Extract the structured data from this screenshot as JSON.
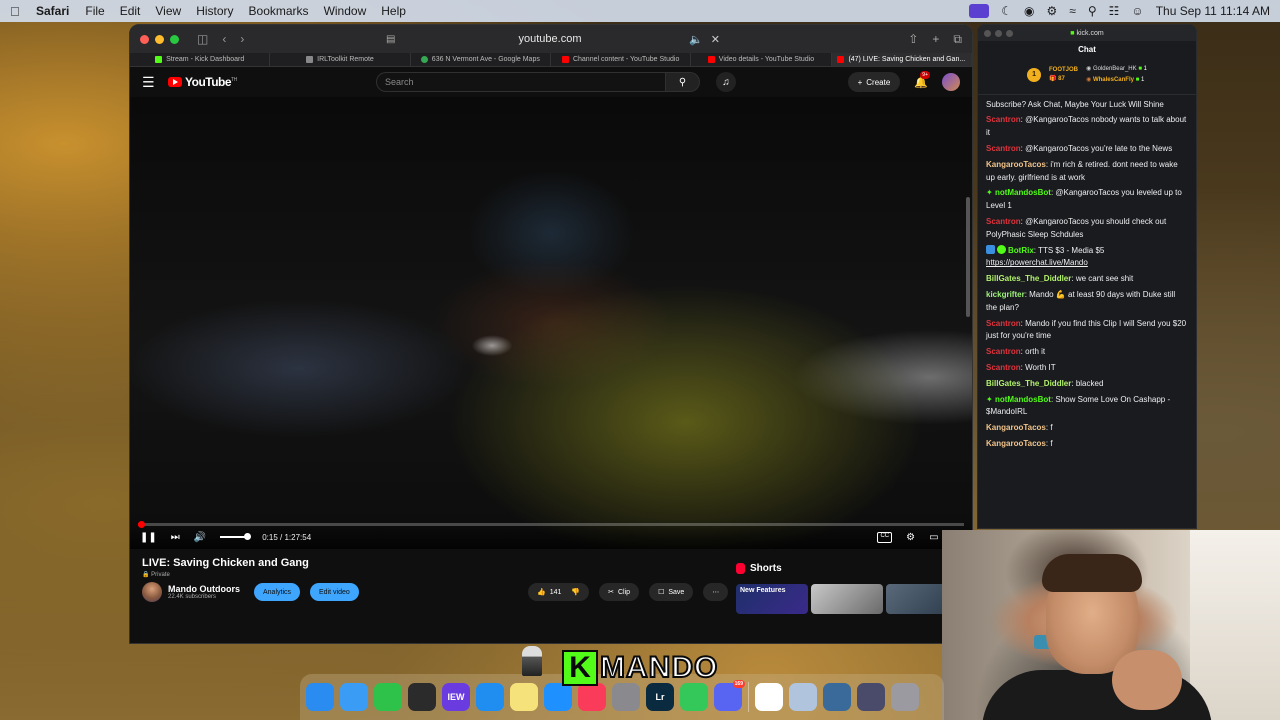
{
  "menubar": {
    "app": "Safari",
    "items": [
      "File",
      "Edit",
      "View",
      "History",
      "Bookmarks",
      "Window",
      "Help"
    ],
    "clock": "Thu Sep 11  11:14 AM"
  },
  "safari": {
    "url": "youtube.com",
    "tabs": [
      {
        "label": "Stream - Kick Dashboard",
        "color": "#53fc18"
      },
      {
        "label": "IRLToolkit Remote",
        "color": "#888888"
      },
      {
        "label": "636 N Vermont Ave - Google Maps",
        "color": "#34a853"
      },
      {
        "label": "Channel content - YouTube Studio",
        "color": "#ff0000"
      },
      {
        "label": "Video details - YouTube Studio",
        "color": "#ff0000"
      },
      {
        "label": "(47) LIVE: Saving Chicken and Gan...",
        "color": "#ff0000"
      }
    ]
  },
  "youtube": {
    "logo_text": "YouTube",
    "logo_sup": "TH",
    "search_placeholder": "Search",
    "create_label": "Create",
    "notif_count": "9+",
    "player": {
      "time": "0:15 / 1:27:54",
      "progress_fraction": 0.003,
      "cc_label": "CC"
    },
    "video_title": "LIVE: Saving Chicken and Gang",
    "privacy": "Private",
    "channel_name": "Mando Outdoors",
    "subscribers": "22.4K subscribers",
    "analytics_label": "Analytics",
    "edit_video_label": "Edit video",
    "like_count": "141",
    "clip_label": "Clip",
    "save_label": "Save",
    "shorts_label": "Shorts",
    "shorts_thumb_text": "New Features"
  },
  "kick": {
    "url": "kick.com",
    "title": "Chat",
    "pinned": {
      "rank": "1",
      "user": "FOOTJOB",
      "count": "87",
      "list": [
        {
          "name": "GoldenBear_HK",
          "count": "1"
        },
        {
          "name": "WhalesCanFly",
          "count": "1"
        }
      ]
    },
    "messages": [
      {
        "user": "",
        "text": "Subscribe? Ask Chat, Maybe Your Luck Will Shine",
        "color": "u-red",
        "icon": ""
      },
      {
        "user": "Scantron",
        "text": "@KangarooTacos nobody wants to talk about it",
        "color": "u-red",
        "icon": ""
      },
      {
        "user": "Scantron",
        "text": "@KangarooTacos you're late to the News",
        "color": "u-red",
        "icon": ""
      },
      {
        "user": "KangarooTacos",
        "text": "i'm rich & retired. dont need to wake up early. girlfriend is at work",
        "color": "u-yel",
        "icon": ""
      },
      {
        "user": "notMandosBot",
        "text": "@KangarooTacos you leveled up to Level 1",
        "color": "u-grn",
        "icon": "spark"
      },
      {
        "user": "Scantron",
        "text": "@KangarooTacos you should check out PolyPhasic Sleep Schdules",
        "color": "u-red",
        "icon": ""
      },
      {
        "user": "BotRix",
        "text": "TTS $3 - Media $5",
        "link": "https://powerchat.live/Mando",
        "color": "u-grn",
        "icon": "bot"
      },
      {
        "user": "BillGates_The_Diddler",
        "text": "we cant see shit",
        "color": "u-lim",
        "icon": ""
      },
      {
        "user": "kickgrifter",
        "text": "Mando 💪 at least 90 days with Duke still the plan?",
        "color": "u-lgr",
        "icon": ""
      },
      {
        "user": "Scantron",
        "text": "Mando if you find this Clip I will Send you $20 just for you're time",
        "color": "u-red",
        "icon": ""
      },
      {
        "user": "Scantron",
        "text": "orth it",
        "color": "u-red",
        "icon": ""
      },
      {
        "user": "Scantron",
        "text": "Worth IT",
        "color": "u-red",
        "icon": ""
      },
      {
        "user": "BillGates_The_Diddler",
        "text": "blacked",
        "color": "u-lim",
        "icon": ""
      },
      {
        "user": "notMandosBot",
        "text": "Show Some Love On Cashapp - $MandoIRL",
        "color": "u-grn",
        "icon": "spark"
      },
      {
        "user": "KangarooTacos",
        "text": "f",
        "color": "u-yel",
        "icon": ""
      },
      {
        "user": "KangarooTacos",
        "text": "f",
        "color": "u-yel",
        "icon": ""
      }
    ]
  },
  "dock": {
    "icons": [
      {
        "name": "finder",
        "label": "",
        "color": "#2a8cf0"
      },
      {
        "name": "mail",
        "label": "",
        "color": "#3a9cf5"
      },
      {
        "name": "facetime",
        "label": "",
        "color": "#2ec24a"
      },
      {
        "name": "obs",
        "label": "",
        "color": "#2b2b2b"
      },
      {
        "name": "iew",
        "label": "IEW",
        "color": "#6a3ce0"
      },
      {
        "name": "safari",
        "label": "",
        "color": "#1f8ef0"
      },
      {
        "name": "notes",
        "label": "",
        "color": "#f6e27a"
      },
      {
        "name": "app-store",
        "label": "",
        "color": "#1e90ff"
      },
      {
        "name": "music",
        "label": "",
        "color": "#fa3c5a"
      },
      {
        "name": "settings",
        "label": "",
        "color": "#8a8a8e"
      },
      {
        "name": "lightroom",
        "label": "Lr",
        "color": "#0a2a40"
      },
      {
        "name": "messages",
        "label": "",
        "color": "#34c759"
      },
      {
        "name": "discord",
        "label": "",
        "color": "#5865f2",
        "badge": "169"
      },
      {
        "name": "capcut",
        "label": "",
        "color": "#ffffff"
      },
      {
        "name": "preview",
        "label": "",
        "color": "#b0c4de"
      },
      {
        "name": "quicktime",
        "label": "",
        "color": "#3a6a9a"
      },
      {
        "name": "downloads",
        "label": "",
        "color": "#4a4a6a"
      },
      {
        "name": "trash",
        "label": "",
        "color": "#9a9aa0"
      }
    ]
  },
  "brand": {
    "letter": "K",
    "name": "MANDO"
  }
}
